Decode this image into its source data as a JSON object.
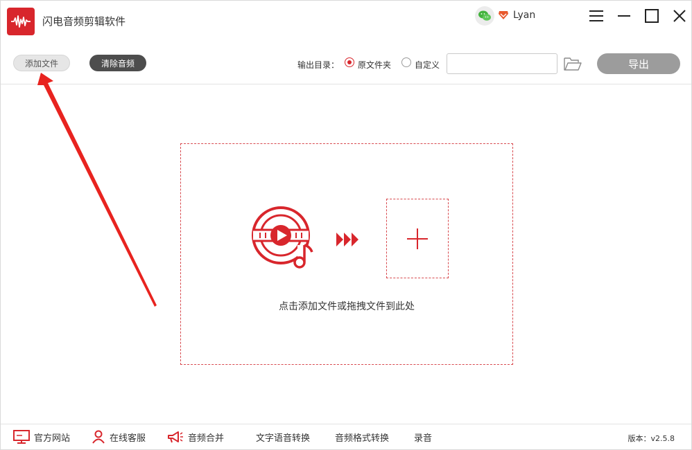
{
  "app": {
    "title": "闪电音频剪辑软件",
    "username": "Lyan",
    "brand_color": "#d8262c",
    "logo_icon": "waveform-icon"
  },
  "header": {
    "wechat_icon": "wechat-icon",
    "vip_icon": "diamond-icon",
    "window_controls": [
      "menu-icon",
      "minimize-icon",
      "maximize-icon",
      "close-icon"
    ]
  },
  "toolbar": {
    "add_file_label": "添加文件",
    "clear_audio_label": "清除音频",
    "output_dir_label": "输出目录：",
    "radio_original_label": "原文件夹",
    "radio_custom_label": "自定义",
    "selected_output": "原文件夹",
    "path_value": "",
    "export_label": "导出"
  },
  "drop_zone": {
    "hint": "点击添加文件或拖拽文件到此处",
    "border_color": "#d8484d"
  },
  "bottom_bar": {
    "items": [
      {
        "label": "官方网站",
        "icon": "monitor-icon"
      },
      {
        "label": "在线客服",
        "icon": "person-icon"
      },
      {
        "label": "音频合并",
        "icon": "megaphone-icon"
      },
      {
        "label": "文字语音转换",
        "icon": ""
      },
      {
        "label": "音频格式转换",
        "icon": ""
      },
      {
        "label": "录音",
        "icon": ""
      }
    ],
    "version": "版本：v2.5.8"
  },
  "annotation": {
    "arrow_color": "#e8231f"
  }
}
